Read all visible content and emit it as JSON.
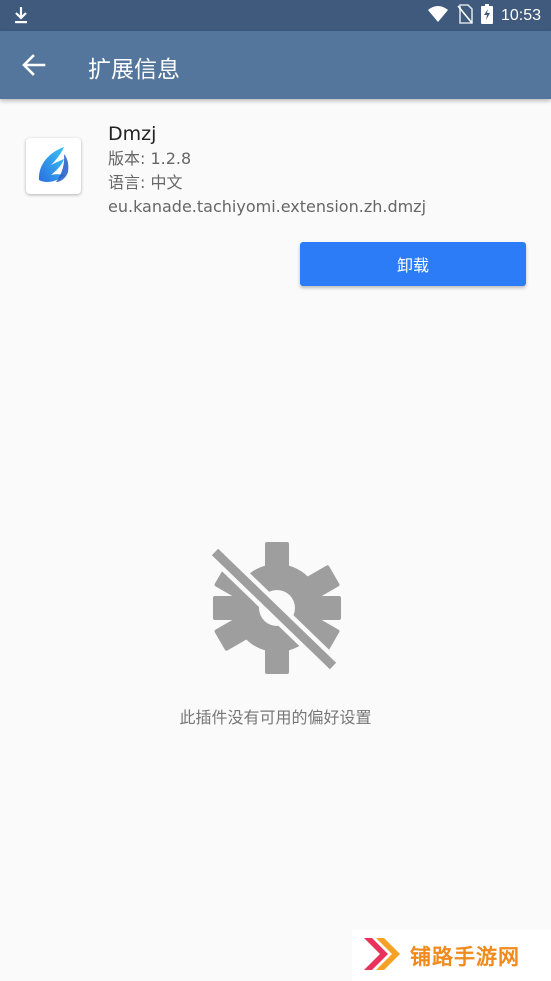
{
  "status_bar": {
    "time": "10:53",
    "icons": [
      "download-icon",
      "wifi-icon",
      "no-sim-icon",
      "battery-charging-icon"
    ]
  },
  "app_bar": {
    "title": "扩展信息",
    "back_icon": "arrow-left-icon"
  },
  "extension": {
    "name": "Dmzj",
    "version": "版本: 1.2.8",
    "language": "语言: 中文",
    "package": "eu.kanade.tachiyomi.extension.zh.dmzj",
    "icon": "feather-icon"
  },
  "actions": {
    "uninstall_label": "卸载"
  },
  "empty_state": {
    "icon": "settings-off-icon",
    "message": "此插件没有可用的偏好设置"
  },
  "watermark": {
    "text": "铺路手游网"
  },
  "colors": {
    "status_bar": "#3f5a7d",
    "app_bar": "#54769c",
    "button": "#2b7cf6",
    "background": "#fafafa"
  }
}
